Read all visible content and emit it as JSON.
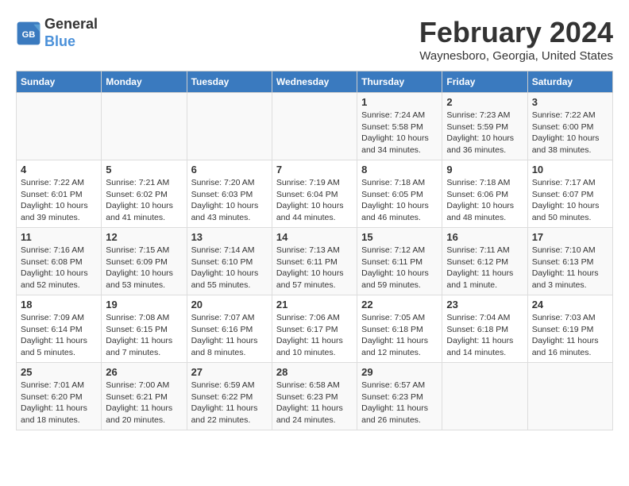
{
  "logo": {
    "text_general": "General",
    "text_blue": "Blue"
  },
  "title": "February 2024",
  "subtitle": "Waynesboro, Georgia, United States",
  "days_of_week": [
    "Sunday",
    "Monday",
    "Tuesday",
    "Wednesday",
    "Thursday",
    "Friday",
    "Saturday"
  ],
  "weeks": [
    [
      {
        "day": "",
        "info": ""
      },
      {
        "day": "",
        "info": ""
      },
      {
        "day": "",
        "info": ""
      },
      {
        "day": "",
        "info": ""
      },
      {
        "day": "1",
        "info": "Sunrise: 7:24 AM\nSunset: 5:58 PM\nDaylight: 10 hours\nand 34 minutes."
      },
      {
        "day": "2",
        "info": "Sunrise: 7:23 AM\nSunset: 5:59 PM\nDaylight: 10 hours\nand 36 minutes."
      },
      {
        "day": "3",
        "info": "Sunrise: 7:22 AM\nSunset: 6:00 PM\nDaylight: 10 hours\nand 38 minutes."
      }
    ],
    [
      {
        "day": "4",
        "info": "Sunrise: 7:22 AM\nSunset: 6:01 PM\nDaylight: 10 hours\nand 39 minutes."
      },
      {
        "day": "5",
        "info": "Sunrise: 7:21 AM\nSunset: 6:02 PM\nDaylight: 10 hours\nand 41 minutes."
      },
      {
        "day": "6",
        "info": "Sunrise: 7:20 AM\nSunset: 6:03 PM\nDaylight: 10 hours\nand 43 minutes."
      },
      {
        "day": "7",
        "info": "Sunrise: 7:19 AM\nSunset: 6:04 PM\nDaylight: 10 hours\nand 44 minutes."
      },
      {
        "day": "8",
        "info": "Sunrise: 7:18 AM\nSunset: 6:05 PM\nDaylight: 10 hours\nand 46 minutes."
      },
      {
        "day": "9",
        "info": "Sunrise: 7:18 AM\nSunset: 6:06 PM\nDaylight: 10 hours\nand 48 minutes."
      },
      {
        "day": "10",
        "info": "Sunrise: 7:17 AM\nSunset: 6:07 PM\nDaylight: 10 hours\nand 50 minutes."
      }
    ],
    [
      {
        "day": "11",
        "info": "Sunrise: 7:16 AM\nSunset: 6:08 PM\nDaylight: 10 hours\nand 52 minutes."
      },
      {
        "day": "12",
        "info": "Sunrise: 7:15 AM\nSunset: 6:09 PM\nDaylight: 10 hours\nand 53 minutes."
      },
      {
        "day": "13",
        "info": "Sunrise: 7:14 AM\nSunset: 6:10 PM\nDaylight: 10 hours\nand 55 minutes."
      },
      {
        "day": "14",
        "info": "Sunrise: 7:13 AM\nSunset: 6:11 PM\nDaylight: 10 hours\nand 57 minutes."
      },
      {
        "day": "15",
        "info": "Sunrise: 7:12 AM\nSunset: 6:11 PM\nDaylight: 10 hours\nand 59 minutes."
      },
      {
        "day": "16",
        "info": "Sunrise: 7:11 AM\nSunset: 6:12 PM\nDaylight: 11 hours\nand 1 minute."
      },
      {
        "day": "17",
        "info": "Sunrise: 7:10 AM\nSunset: 6:13 PM\nDaylight: 11 hours\nand 3 minutes."
      }
    ],
    [
      {
        "day": "18",
        "info": "Sunrise: 7:09 AM\nSunset: 6:14 PM\nDaylight: 11 hours\nand 5 minutes."
      },
      {
        "day": "19",
        "info": "Sunrise: 7:08 AM\nSunset: 6:15 PM\nDaylight: 11 hours\nand 7 minutes."
      },
      {
        "day": "20",
        "info": "Sunrise: 7:07 AM\nSunset: 6:16 PM\nDaylight: 11 hours\nand 8 minutes."
      },
      {
        "day": "21",
        "info": "Sunrise: 7:06 AM\nSunset: 6:17 PM\nDaylight: 11 hours\nand 10 minutes."
      },
      {
        "day": "22",
        "info": "Sunrise: 7:05 AM\nSunset: 6:18 PM\nDaylight: 11 hours\nand 12 minutes."
      },
      {
        "day": "23",
        "info": "Sunrise: 7:04 AM\nSunset: 6:18 PM\nDaylight: 11 hours\nand 14 minutes."
      },
      {
        "day": "24",
        "info": "Sunrise: 7:03 AM\nSunset: 6:19 PM\nDaylight: 11 hours\nand 16 minutes."
      }
    ],
    [
      {
        "day": "25",
        "info": "Sunrise: 7:01 AM\nSunset: 6:20 PM\nDaylight: 11 hours\nand 18 minutes."
      },
      {
        "day": "26",
        "info": "Sunrise: 7:00 AM\nSunset: 6:21 PM\nDaylight: 11 hours\nand 20 minutes."
      },
      {
        "day": "27",
        "info": "Sunrise: 6:59 AM\nSunset: 6:22 PM\nDaylight: 11 hours\nand 22 minutes."
      },
      {
        "day": "28",
        "info": "Sunrise: 6:58 AM\nSunset: 6:23 PM\nDaylight: 11 hours\nand 24 minutes."
      },
      {
        "day": "29",
        "info": "Sunrise: 6:57 AM\nSunset: 6:23 PM\nDaylight: 11 hours\nand 26 minutes."
      },
      {
        "day": "",
        "info": ""
      },
      {
        "day": "",
        "info": ""
      }
    ]
  ]
}
